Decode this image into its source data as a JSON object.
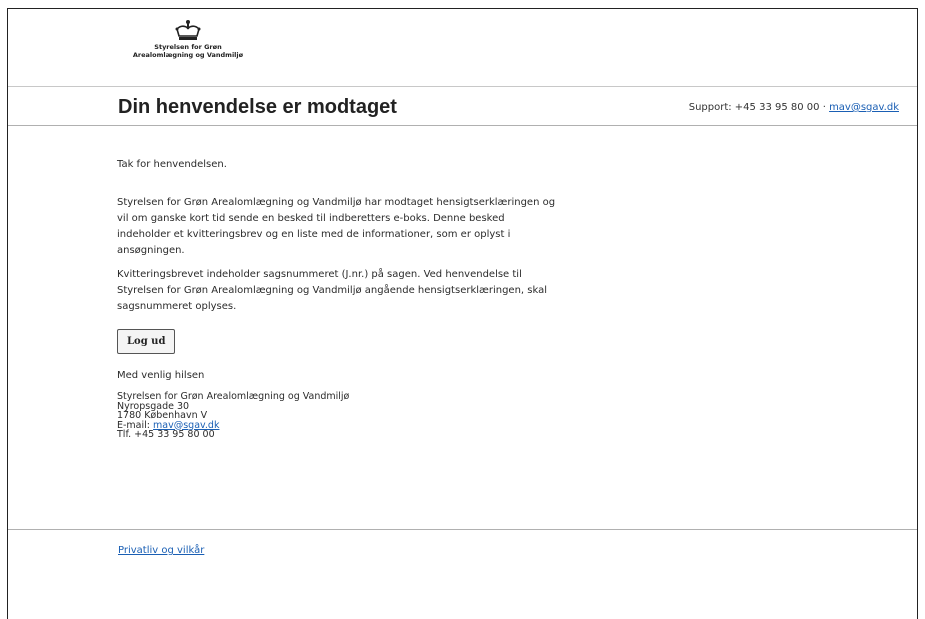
{
  "logo": {
    "icon": "crown-icon",
    "line1": "Styrelsen for Grøn",
    "line2": "Arealomlægning og Vandmiljø"
  },
  "header": {
    "title": "Din henvendelse er modtaget",
    "support_prefix": "Support: +45 33 95 80 00 · ",
    "support_email": "mav@sgav.dk"
  },
  "content": {
    "intro": "Tak for henvendelsen.",
    "paragraph1": "Styrelsen for Grøn Arealomlægning og Vandmiljø har modtaget hensigtserklæringen og vil om ganske kort tid sende en besked til indberetters e-boks. Denne besked indeholder et kvitteringsbrev og en liste med de informationer, som er oplyst i ansøgningen.",
    "paragraph2": "Kvitteringsbrevet indeholder sagsnummeret (J.nr.) på sagen. Ved henvendelse til Styrelsen for Grøn Arealomlægning og Vandmiljø angående hensigtserklæringen, skal sagsnummeret oplyses.",
    "logout_label": "Log ud",
    "sign_off": "Med venlig hilsen"
  },
  "address": {
    "org": "Styrelsen for Grøn Arealomlægning og Vandmiljø",
    "street": "Nyropsgade 30",
    "city": "1780 København V",
    "email_label": "E-mail: ",
    "email": "mav@sgav.dk",
    "phone": "Tlf. +45 33 95 80 00"
  },
  "footer": {
    "privacy_link": "Privatliv og vilkår"
  },
  "colors": {
    "link": "#1a5fb4",
    "separator": "#b0b0b0"
  }
}
